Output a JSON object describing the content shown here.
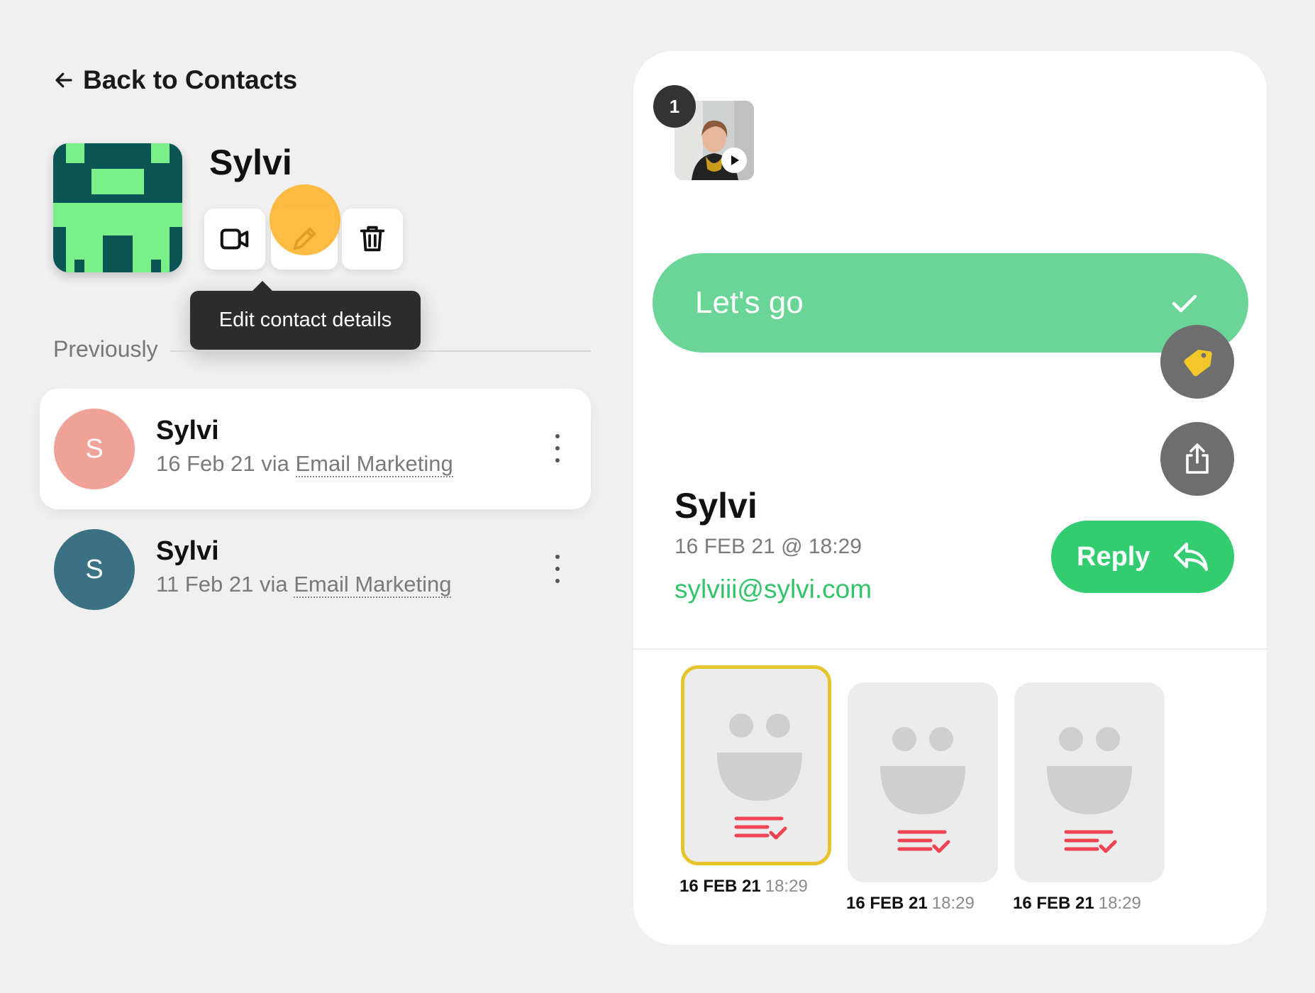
{
  "nav": {
    "back_label": "Back to Contacts"
  },
  "contact": {
    "name": "Sylvi",
    "actions": {
      "video": "video-icon",
      "edit": "pencil-icon",
      "delete": "trash-icon"
    },
    "tooltip": "Edit contact details"
  },
  "history": {
    "heading": "Previously",
    "items": [
      {
        "initial": "S",
        "name": "Sylvi",
        "date": "16 Feb 21",
        "via": "via",
        "source": "Email Marketing",
        "avatar_color": "#f0a198",
        "active": true
      },
      {
        "initial": "S",
        "name": "Sylvi",
        "date": "11 Feb 21",
        "via": "via",
        "source": "Email Marketing",
        "avatar_color": "#3a7183",
        "active": false
      }
    ]
  },
  "detail": {
    "video_badge": "1",
    "answer": "Let's go",
    "sender_name": "Sylvi",
    "sender_date": "16 FEB 21 @ 18:29",
    "sender_email": "sylviii@sylvi.com",
    "reply_label": "Reply",
    "responses": [
      {
        "date": "16 FEB 21",
        "time": "18:29",
        "selected": true
      },
      {
        "date": "16 FEB 21",
        "time": "18:29",
        "selected": false
      },
      {
        "date": "16 FEB 21",
        "time": "18:29",
        "selected": false
      }
    ]
  },
  "colors": {
    "accent_green": "#33cc71",
    "answer_green": "#6ad596",
    "selected_border": "#e5c52e",
    "status_red": "#f04455",
    "cursor_highlight": "#ffb228"
  }
}
